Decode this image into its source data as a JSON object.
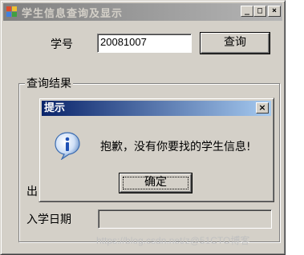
{
  "window": {
    "title": "学生信息查询及显示",
    "minimize": "_",
    "maximize": "□",
    "close": "×"
  },
  "form": {
    "student_id_label": "学号",
    "student_id_value": "20081007",
    "query_button": "查询",
    "result_group_label": "查询结果",
    "partial_label": "出",
    "enroll_date_label": "入学日期",
    "enroll_date_value": ""
  },
  "dialog": {
    "title": "提示",
    "close": "×",
    "message": "抱歉，没有你要找的学生信息!",
    "ok_button": "确定",
    "icon": "information-icon"
  },
  "watermark": "https://blog.csdn.net/z@51CTO博客"
}
